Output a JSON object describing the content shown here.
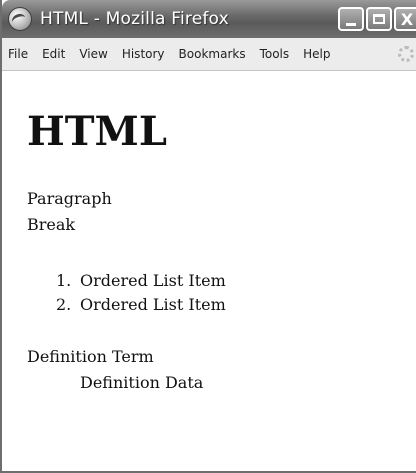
{
  "window": {
    "title": "HTML - Mozilla Firefox",
    "controls": {
      "minimize": "",
      "maximize": "",
      "close": "X"
    }
  },
  "menu": [
    "File",
    "Edit",
    "View",
    "History",
    "Bookmarks",
    "Tools",
    "Help"
  ],
  "page": {
    "heading": "HTML",
    "paragraph": "Paragraph",
    "break_line": "Break",
    "ordered_list": [
      {
        "number": "1.",
        "text": "Ordered List Item"
      },
      {
        "number": "2.",
        "text": "Ordered List Item"
      }
    ],
    "definition_term": "Definition Term",
    "definition_data": "Definition Data"
  }
}
